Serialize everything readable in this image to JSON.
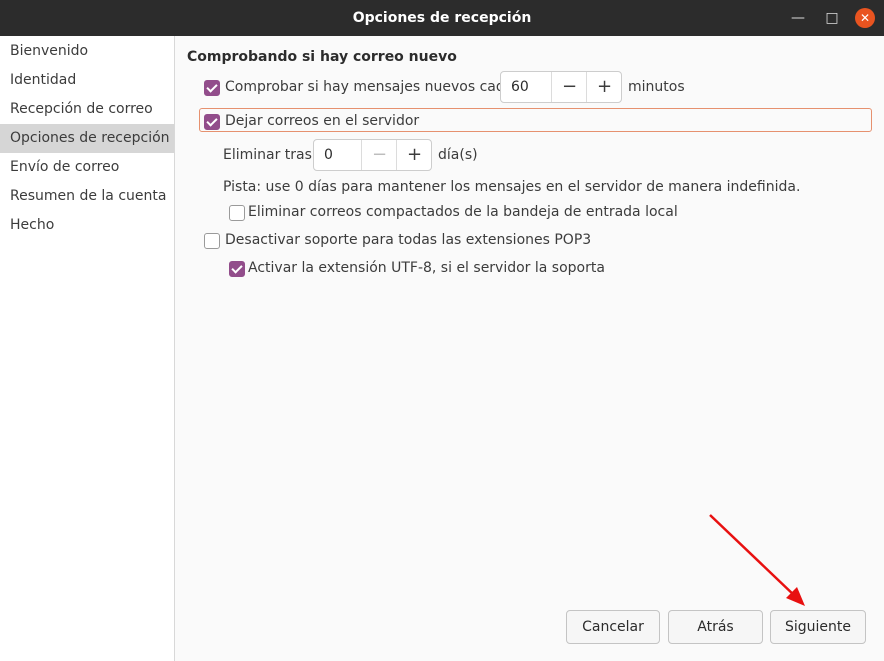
{
  "window": {
    "title": "Opciones de recepción",
    "minimize_icon": "minimize-icon",
    "maximize_icon": "maximize-icon",
    "close_icon": "close-icon",
    "close_color": "#e95420"
  },
  "sidebar": {
    "items": [
      {
        "label": "Bienvenido"
      },
      {
        "label": "Identidad"
      },
      {
        "label": "Recepción de correo"
      },
      {
        "label": "Opciones de recepción",
        "selected": true
      },
      {
        "label": "Envío de correo"
      },
      {
        "label": "Resumen de la cuenta"
      },
      {
        "label": "Hecho"
      }
    ]
  },
  "main": {
    "heading": "Comprobando si hay correo nuevo",
    "check_new": {
      "label": "Comprobar si hay mensajes nuevos cada",
      "checked": true,
      "value": "60",
      "unit": "minutos"
    },
    "leave_on_server": {
      "label": "Dejar correos en el servidor",
      "checked": true
    },
    "delete_after": {
      "label": "Eliminar tras",
      "value": "0",
      "unit": "día(s)"
    },
    "hint": "Pista: use 0 días para mantener los mensajes en el servidor de manera indefinida.",
    "delete_compacted": {
      "label": "Eliminar correos compactados de la bandeja de entrada local",
      "checked": false
    },
    "disable_pop3_ext": {
      "label": "Desactivar soporte para todas las extensiones POP3",
      "checked": false
    },
    "utf8": {
      "label": "Activar la extensión UTF-8, si el servidor la soporta",
      "checked": true
    }
  },
  "buttons": {
    "cancel": "Cancelar",
    "back": "Atrás",
    "next": "Siguiente"
  },
  "colors": {
    "accent": "#924d8b",
    "focus": "#e6916f",
    "titlebar": "#2c2c2c",
    "annotation_arrow": "#e81010"
  }
}
